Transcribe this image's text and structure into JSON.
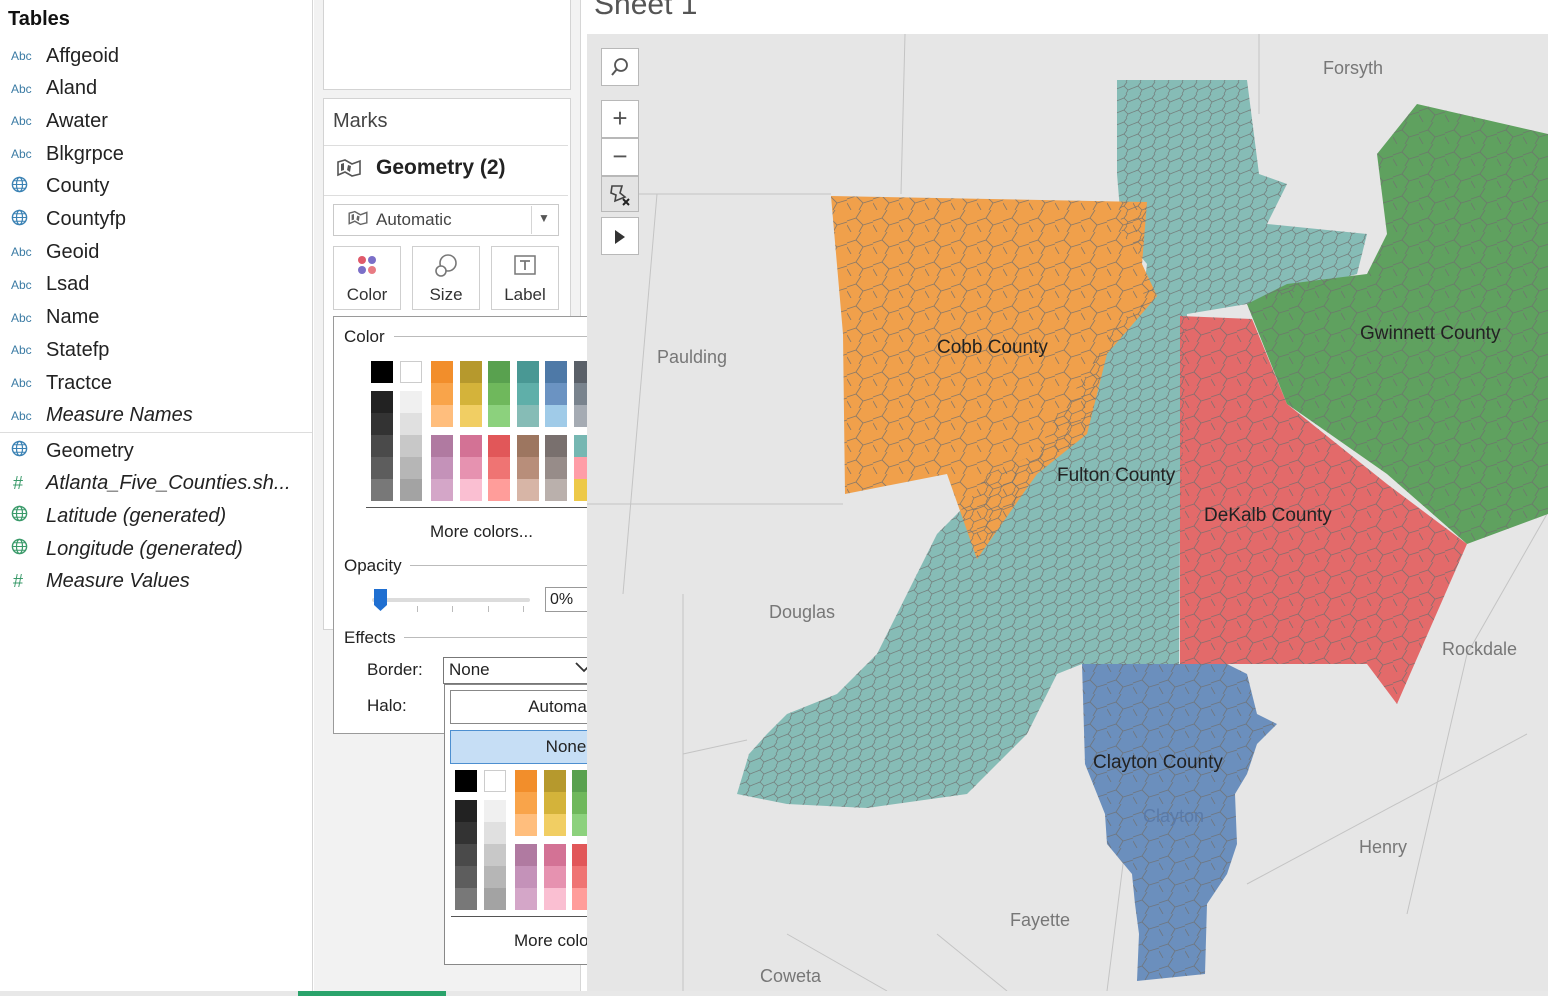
{
  "data_pane": {
    "title": "Tables",
    "fields": [
      {
        "type": "Abc",
        "name": "Affgeoid",
        "italic": false,
        "icon": "string-icon"
      },
      {
        "type": "Abc",
        "name": "Aland",
        "italic": false,
        "icon": "string-icon"
      },
      {
        "type": "Abc",
        "name": "Awater",
        "italic": false,
        "icon": "string-icon"
      },
      {
        "type": "Abc",
        "name": "Blkgrpce",
        "italic": false,
        "icon": "string-icon"
      },
      {
        "type": "globe",
        "name": "County",
        "italic": false,
        "icon": "globe-icon"
      },
      {
        "type": "globe",
        "name": "Countyfp",
        "italic": false,
        "icon": "globe-icon"
      },
      {
        "type": "Abc",
        "name": "Geoid",
        "italic": false,
        "icon": "string-icon"
      },
      {
        "type": "Abc",
        "name": "Lsad",
        "italic": false,
        "icon": "string-icon"
      },
      {
        "type": "Abc",
        "name": "Name",
        "italic": false,
        "icon": "string-icon"
      },
      {
        "type": "Abc",
        "name": "Statefp",
        "italic": false,
        "icon": "string-icon"
      },
      {
        "type": "Abc",
        "name": "Tractce",
        "italic": false,
        "icon": "string-icon"
      },
      {
        "type": "Abc",
        "name": "Measure Names",
        "italic": true,
        "icon": "string-icon"
      }
    ],
    "measures": [
      {
        "type": "globe",
        "name": "Geometry",
        "italic": false,
        "icon": "globe-icon"
      },
      {
        "type": "#",
        "name": "Atlanta_Five_Counties.sh...",
        "italic": true,
        "icon": "number-icon"
      },
      {
        "type": "globe-g",
        "name": "Latitude (generated)",
        "italic": true,
        "icon": "globe-icon"
      },
      {
        "type": "globe-g",
        "name": "Longitude (generated)",
        "italic": true,
        "icon": "globe-icon"
      },
      {
        "type": "#",
        "name": "Measure Values",
        "italic": true,
        "icon": "number-icon"
      }
    ]
  },
  "marks": {
    "title": "Marks",
    "layer": "Geometry (2)",
    "mark_type": "Automatic",
    "buttons": {
      "color": "Color",
      "size": "Size",
      "label": "Label"
    }
  },
  "color_popup": {
    "color_section": "Color",
    "more_colors": "More colors...",
    "opacity_section": "Opacity",
    "opacity_value": "0%",
    "opacity_fraction": 0.0,
    "effects_section": "Effects",
    "border_label": "Border:",
    "border_value": "None",
    "halo_label": "Halo:"
  },
  "border_dropdown": {
    "option_automatic": "Automatic",
    "option_none": "None",
    "more_colors": "More colors..."
  },
  "palette": {
    "grays_dark": [
      "#000000",
      "#222222",
      "#333333",
      "#4a4a4a",
      "#5d5d5d",
      "#787878"
    ],
    "grays_light": [
      "#ffffff",
      "#f0f0f0",
      "#e0e0e0",
      "#c8c8c8",
      "#b6b6b6",
      "#a3a3a3"
    ],
    "top_columns": [
      [
        "#f28e2b",
        "#f9a44a",
        "#ffbe7d"
      ],
      [
        "#b6992d",
        "#d4b33a",
        "#f1ce63"
      ],
      [
        "#59a14f",
        "#6fb85c",
        "#8cd17d"
      ],
      [
        "#499894",
        "#5fafa9",
        "#86bcb6"
      ],
      [
        "#4e79a7",
        "#6b93c2",
        "#a0cbe8"
      ],
      [
        "#5a6068",
        "#79838d",
        "#a5abb3"
      ]
    ],
    "bottom_columns": [
      [
        "#b07aa1",
        "#c492b9",
        "#d4a6c8"
      ],
      [
        "#d37295",
        "#e692b0",
        "#fabfd2"
      ],
      [
        "#e15759",
        "#ef7473",
        "#ff9d9a"
      ],
      [
        "#9d7660",
        "#b88e7a",
        "#d7b5a6"
      ],
      [
        "#79706e",
        "#978c89",
        "#bab0ac"
      ],
      [
        "#76b7b2",
        "#ff9da7",
        "#edc948"
      ]
    ]
  },
  "sheet": {
    "title": "Sheet 1"
  },
  "map": {
    "counties": [
      {
        "name": "Cobb County",
        "color": "#f0a04b"
      },
      {
        "name": "Fulton County",
        "color": "#86bcb6"
      },
      {
        "name": "DeKalb County",
        "color": "#e36a6a"
      },
      {
        "name": "Gwinnett County",
        "color": "#5fa15f"
      },
      {
        "name": "Clayton County",
        "color": "#6b8fbd"
      }
    ],
    "places": [
      "Forsyth",
      "Paulding",
      "Douglas",
      "Rockdale",
      "Henry",
      "Fayette",
      "Coweta",
      "Clayton"
    ],
    "background": "#e6e6e6",
    "tools": {
      "search": "search-icon",
      "zoom_in": "+",
      "zoom_out": "−",
      "pin": "pin-icon",
      "expand": "play-icon"
    }
  }
}
